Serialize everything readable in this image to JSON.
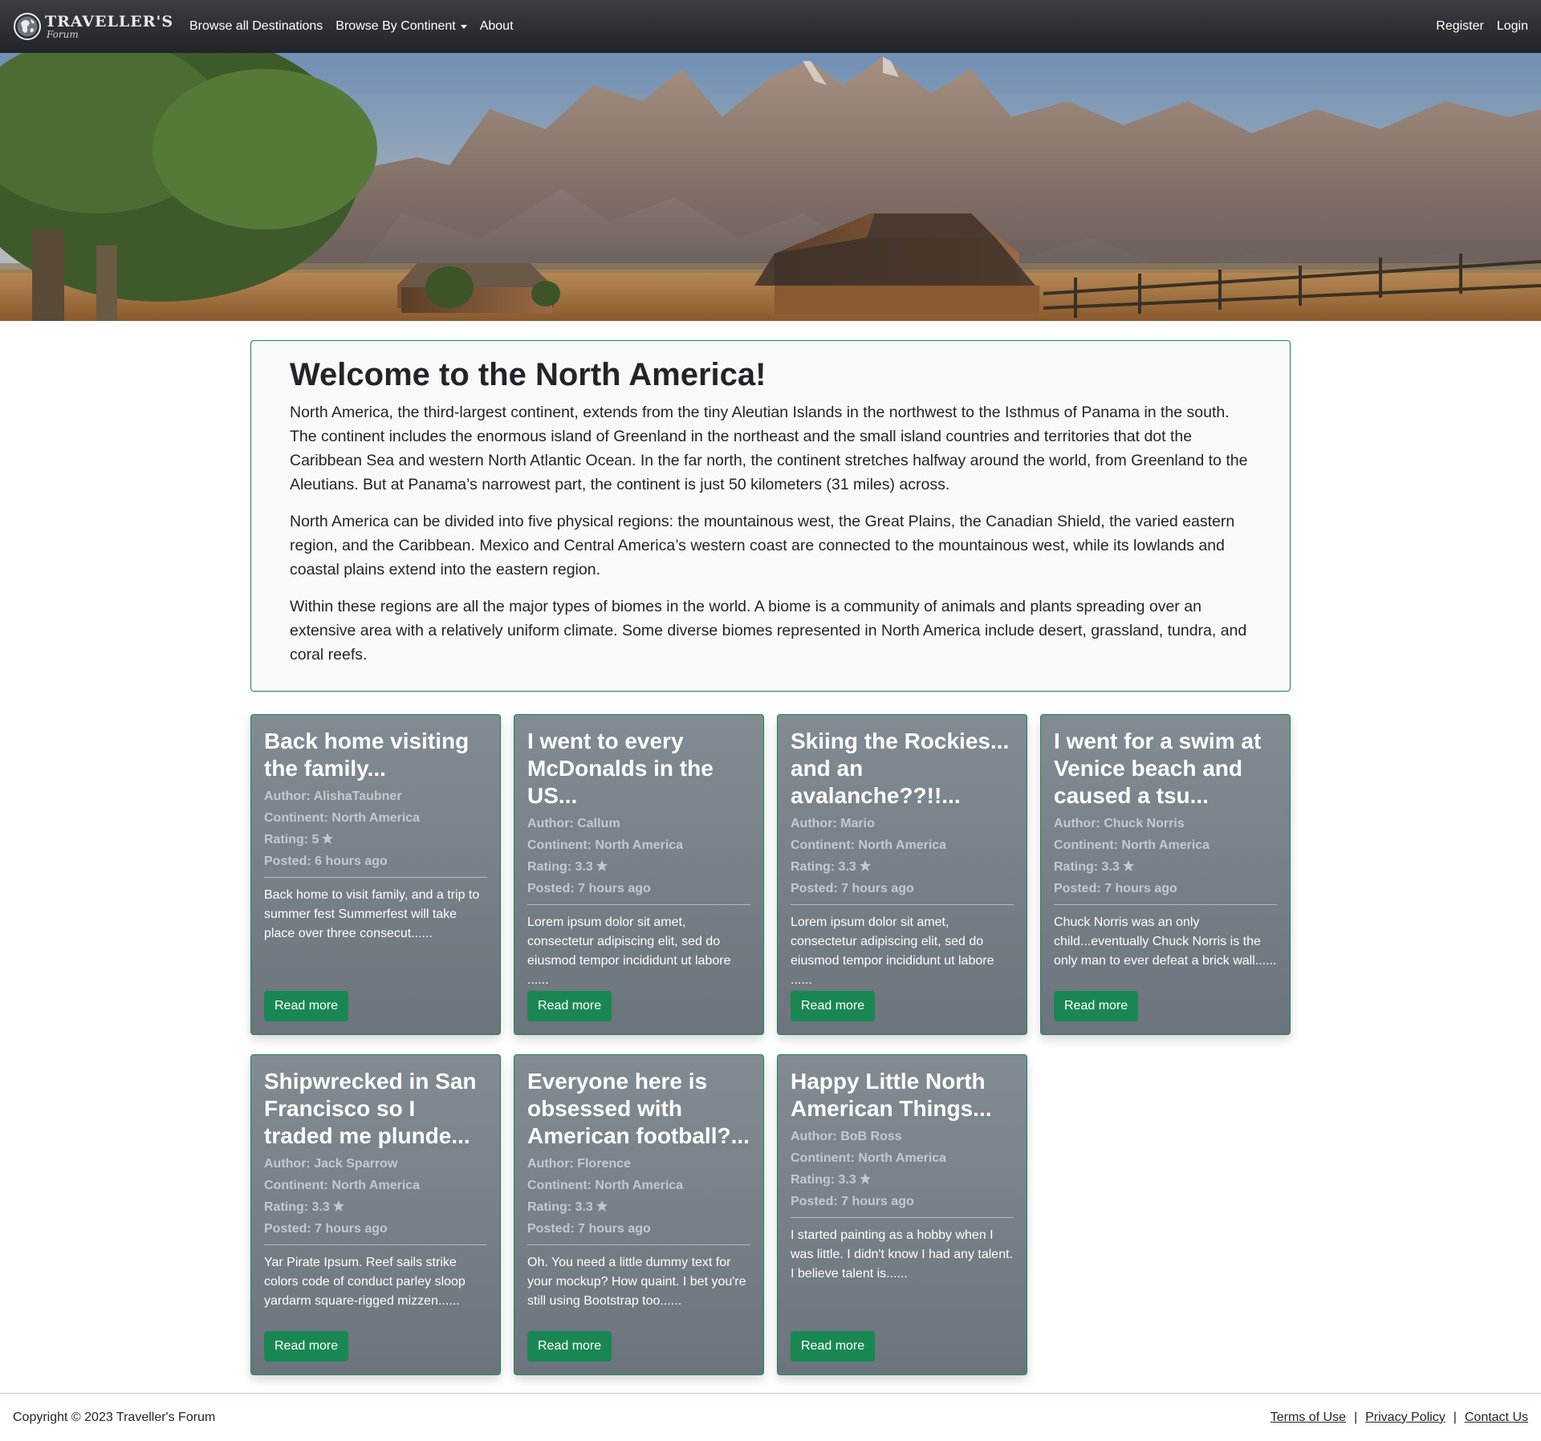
{
  "brand": {
    "name": "TRAVELLER'S",
    "sub": "Forum"
  },
  "nav": {
    "browse_all": "Browse all Destinations",
    "browse_continent": "Browse By Continent",
    "about": "About",
    "register": "Register",
    "login": "Login"
  },
  "welcome": {
    "title": "Welcome to the North America!",
    "p1": "North America, the third-largest continent, extends from the tiny Aleutian Islands in the northwest to the Isthmus of Panama in the south. The continent includes the enormous island of Greenland in the northeast and the small island countries and territories that dot the Caribbean Sea and western North Atlantic Ocean. In the far north, the continent stretches halfway around the world, from Greenland to the Aleutians. But at Panama’s narrowest part, the continent is just 50 kilometers (31 miles) across.",
    "p2": "North America can be divided into five physical regions: the mountainous west, the Great Plains, the Canadian Shield, the varied eastern region, and the Caribbean. Mexico and Central America’s western coast are connected to the mountainous west, while its lowlands and coastal plains extend into the eastern region.",
    "p3": "Within these regions are all the major types of biomes in the world. A biome is a community of animals and plants spreading over an extensive area with a relatively uniform climate. Some diverse biomes represented in North America include desert, grassland, tundra, and coral reefs."
  },
  "posts": [
    {
      "title": "Back home visiting the family...",
      "author": "Author: AlishaTaubner",
      "continent": "Continent: North America",
      "rating": "Rating: 5",
      "posted": "Posted: 6 hours ago",
      "excerpt": "Back home to visit family, and a trip to summer fest Summerfest will take place over three consecut......",
      "button": "Read more"
    },
    {
      "title": "I went to every McDonalds in the US...",
      "author": "Author: Callum",
      "continent": "Continent: North America",
      "rating": "Rating: 3.3",
      "posted": "Posted: 7 hours ago",
      "excerpt": "Lorem ipsum dolor sit amet, consectetur adipiscing elit, sed do eiusmod tempor incididunt ut labore ......",
      "button": "Read more"
    },
    {
      "title": "Skiing the Rockies... and an avalanche??!!...",
      "author": "Author: Mario",
      "continent": "Continent: North America",
      "rating": "Rating: 3.3",
      "posted": "Posted: 7 hours ago",
      "excerpt": "Lorem ipsum dolor sit amet, consectetur adipiscing elit, sed do eiusmod tempor incididunt ut labore ......",
      "button": "Read more"
    },
    {
      "title": "I went for a swim at Venice beach and caused a tsu...",
      "author": "Author: Chuck Norris",
      "continent": "Continent: North America",
      "rating": "Rating: 3.3",
      "posted": "Posted: 7 hours ago",
      "excerpt": "Chuck Norris was an only child...eventually Chuck Norris is the only man to ever defeat a brick wall......",
      "button": "Read more"
    },
    {
      "title": "Shipwrecked in San Francisco so I traded me plunde...",
      "author": "Author: Jack Sparrow",
      "continent": "Continent: North America",
      "rating": "Rating: 3.3",
      "posted": "Posted: 7 hours ago",
      "excerpt": "Yar Pirate Ipsum. Reef sails strike colors code of conduct parley sloop yardarm square-rigged mizzen......",
      "button": "Read more"
    },
    {
      "title": "Everyone here is obsessed with American football?...",
      "author": "Author: Florence",
      "continent": "Continent: North America",
      "rating": "Rating: 3.3",
      "posted": "Posted: 7 hours ago",
      "excerpt": "Oh. You need a little dummy text for your mockup? How quaint. I bet you're still using Bootstrap too......",
      "button": "Read more"
    },
    {
      "title": "Happy Little North American Things...",
      "author": "Author: BoB Ross",
      "continent": "Continent: North America",
      "rating": "Rating: 3.3",
      "posted": "Posted: 7 hours ago",
      "excerpt": "I started painting as a hobby when I was little. I didn't know I had any talent. I believe talent is......",
      "button": "Read more"
    }
  ],
  "footer": {
    "copyright": "Copyright © 2023 Traveller's Forum",
    "terms": "Terms of Use",
    "privacy": "Privacy Policy",
    "contact": "Contact Us",
    "separator": "|"
  },
  "colors": {
    "accent": "#198754",
    "navbar": "#212529",
    "card": "#6c757d"
  },
  "icons": {
    "brand": "globe-icon",
    "rating": "star-icon",
    "dropdown": "caret-down-icon"
  }
}
